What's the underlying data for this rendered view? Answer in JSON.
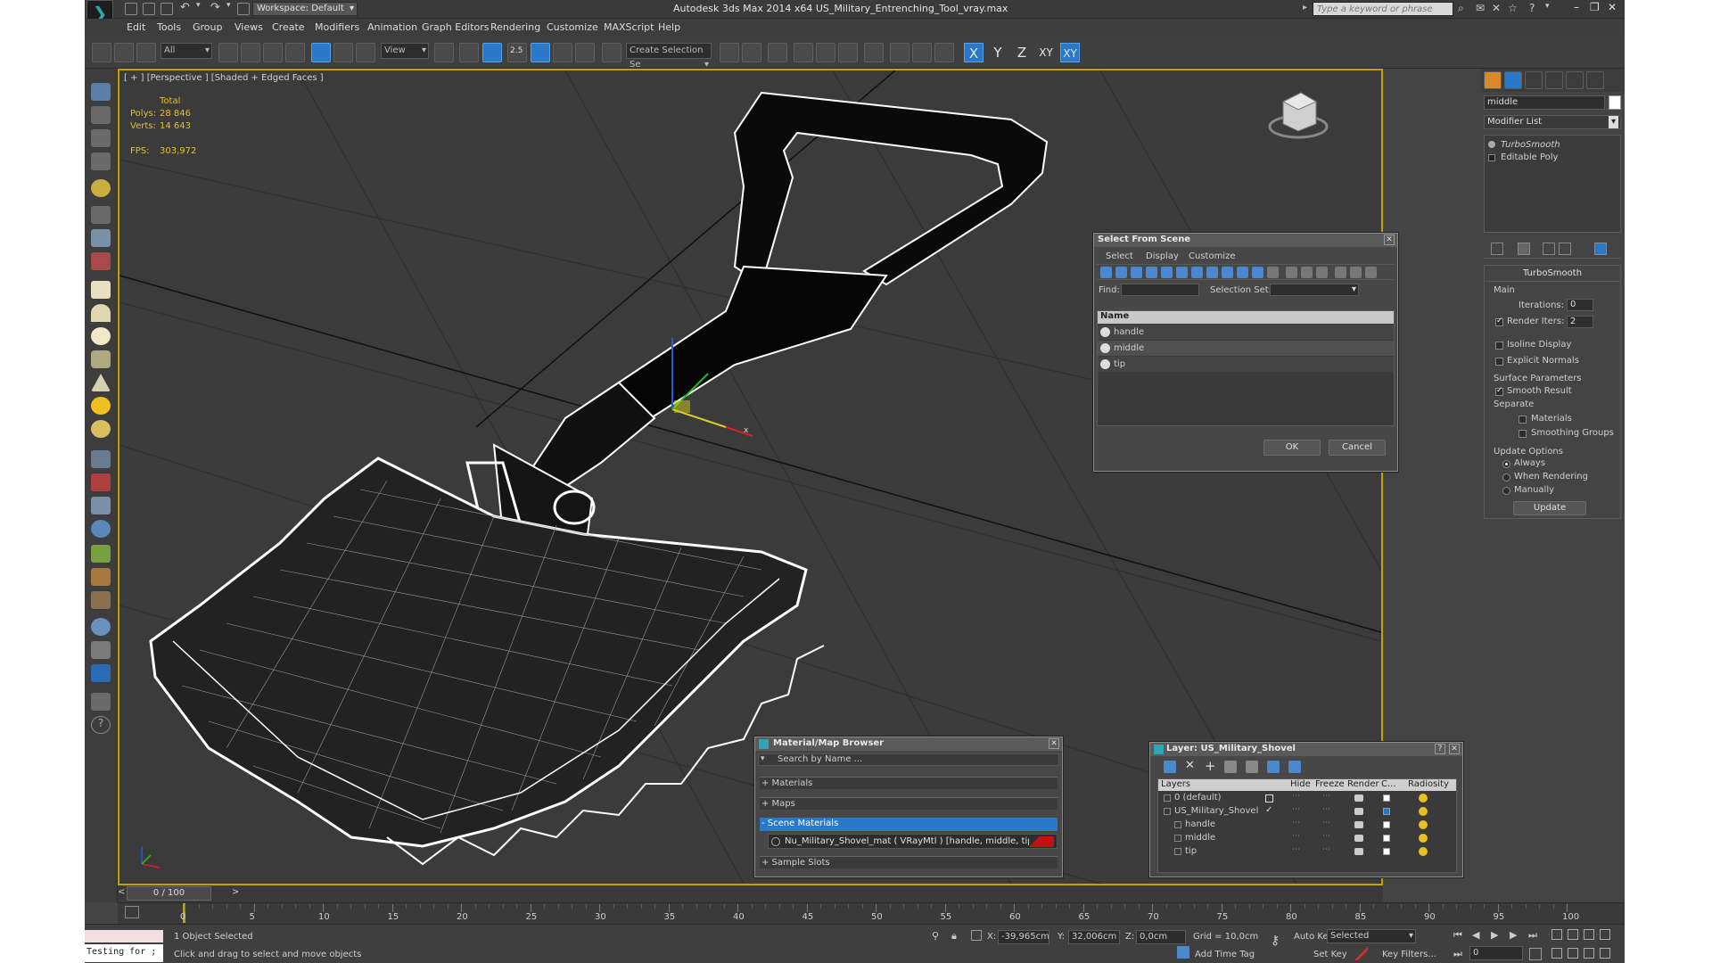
{
  "window": {
    "title": "Autodesk 3ds Max  2014 x64     US_Military_Entrenching_Tool_vray.max",
    "workspace": "Workspace: Default",
    "search_placeholder": "Type a keyword or phrase"
  },
  "menu": [
    "Edit",
    "Tools",
    "Group",
    "Views",
    "Create",
    "Modifiers",
    "Animation",
    "Graph Editors",
    "Rendering",
    "Customize",
    "MAXScript",
    "Help"
  ],
  "toolbar": {
    "filter": "All",
    "ref_coord": "View",
    "selection_set": "Create Selection Se",
    "snap_label": "2.5",
    "axis": [
      "X",
      "Y",
      "Z",
      "XY",
      "XY"
    ]
  },
  "viewport": {
    "label": "[ + ] [Perspective ] [Shaded + Edged Faces ]",
    "stats": {
      "total_label": "Total",
      "polys_label": "Polys:",
      "polys": "28 846",
      "verts_label": "Verts:",
      "verts": "14 643",
      "fps_label": "FPS:",
      "fps": "303,972"
    }
  },
  "command_panel": {
    "object_name": "middle",
    "modifier_list": "Modifier List",
    "stack": [
      "TurboSmooth",
      "Editable Poly"
    ],
    "turbosmooth": {
      "title": "TurboSmooth",
      "main": "Main",
      "iterations_label": "Iterations:",
      "iterations": "0",
      "render_iters_label": "Render Iters:",
      "render_iters": "2",
      "isoline": "Isoline Display",
      "explicit": "Explicit Normals",
      "surface": "Surface Parameters",
      "smooth_result": "Smooth Result",
      "separate": "Separate",
      "materials": "Materials",
      "smoothing_groups": "Smoothing Groups",
      "update_options": "Update Options",
      "always": "Always",
      "when_rendering": "When Rendering",
      "manually": "Manually",
      "update_btn": "Update"
    }
  },
  "select_dialog": {
    "title": "Select From Scene",
    "menus": [
      "Select",
      "Display",
      "Customize"
    ],
    "find_label": "Find:",
    "selset_label": "Selection Set:",
    "column": "Name",
    "items": [
      "handle",
      "middle",
      "tip"
    ],
    "ok": "OK",
    "cancel": "Cancel"
  },
  "material_browser": {
    "title": "Material/Map Browser",
    "search": "Search by Name ...",
    "groups": [
      "+ Materials",
      "+ Maps",
      "- Scene Materials"
    ],
    "scene_material": "Nu_Military_Shovel_mat  ( VRayMtl ) [handle, middle, tip]",
    "sample_slots": "+ Sample Slots"
  },
  "layer_dialog": {
    "title": "Layer: US_Military_Shovel",
    "columns": [
      "Layers",
      "Hide",
      "Freeze",
      "Render",
      "C...",
      "Radiosity"
    ],
    "rows": [
      "0 (default)",
      "US_Military_Shovel",
      "handle",
      "middle",
      "tip"
    ],
    "marker_colors": [
      "#ffffff",
      "#1e78d2",
      "#ffffff",
      "#ffffff",
      "#ffffff"
    ]
  },
  "timeline": {
    "frame": "0 / 100",
    "ticks": [
      "0",
      "5",
      "10",
      "15",
      "20",
      "25",
      "30",
      "35",
      "40",
      "45",
      "50",
      "55",
      "60",
      "65",
      "70",
      "75",
      "80",
      "85",
      "90",
      "95",
      "100"
    ]
  },
  "status": {
    "script_listener": "Testing for ;",
    "selected": "1 Object Selected",
    "prompt": "Click and drag to select and move objects",
    "x_label": "X:",
    "x": "-39,965cm",
    "y_label": "Y:",
    "y": "32,006cm",
    "z_label": "Z:",
    "z": "0,0cm",
    "grid": "Grid = 10,0cm",
    "add_time_tag": "Add Time Tag",
    "auto_key": "Auto Key",
    "set_key": "Set Key",
    "key_mode": "Selected",
    "key_filters": "Key Filters...",
    "frame": "0"
  },
  "colors": {
    "accent": "#2a78c8",
    "viewport_border": "#c8a100",
    "stats": "#e0c030",
    "material_swatch": "#c41010"
  }
}
